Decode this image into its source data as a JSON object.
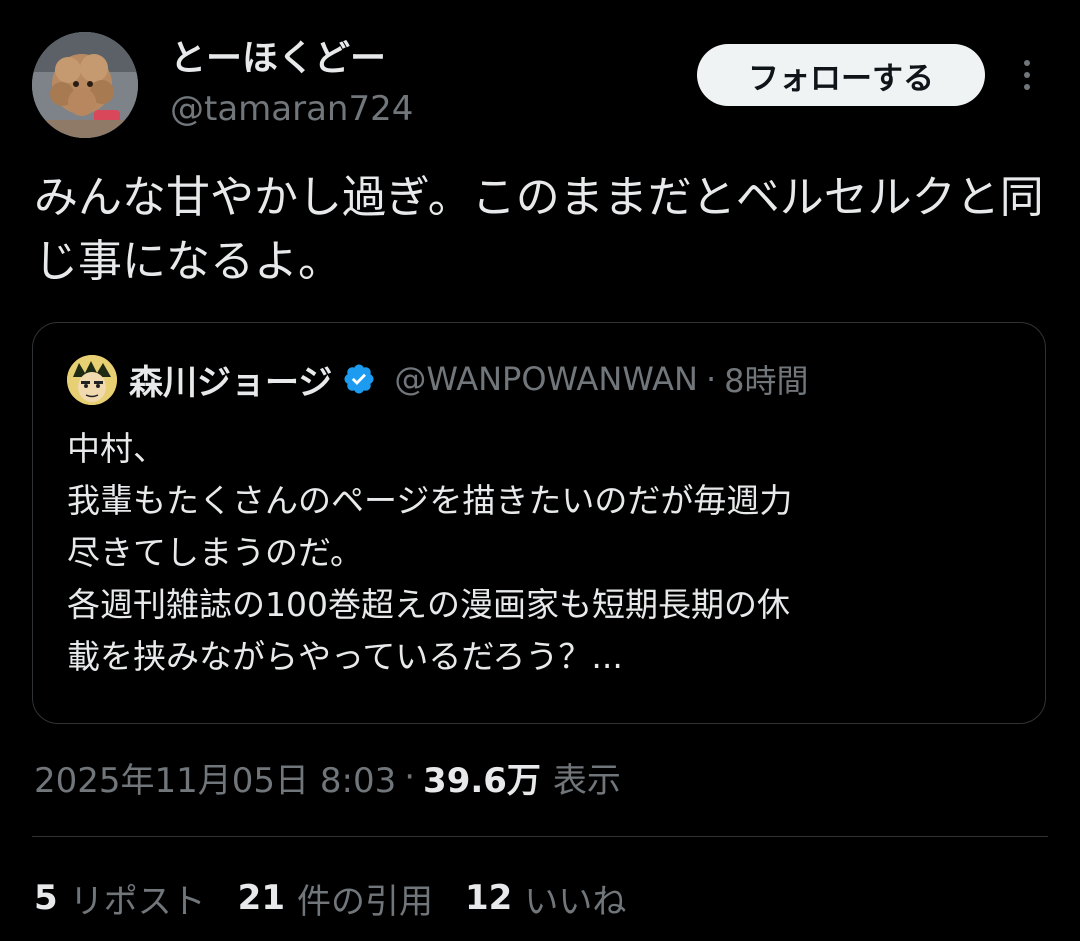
{
  "author": {
    "display_name": "とーほくどー",
    "handle": "@tamaran724",
    "avatar_icon": "poodle-avatar-icon"
  },
  "actions": {
    "follow_label": "フォローする",
    "more_icon": "more-dots-icon"
  },
  "tweet": {
    "text": "みんな甘やかし過ぎ。このままだとベルセルクと同じ事になるよ。"
  },
  "quote": {
    "display_name": "森川ジョージ",
    "verified_icon": "verified-badge-icon",
    "handle": "@WANPOWANWAN",
    "separator": "·",
    "time": "8時間",
    "lines": [
      "中村、",
      "我輩もたくさんのページを描きたいのだが毎週力",
      "尽きてしまうのだ。",
      "各週刊雑誌の100巻超えの漫画家も短期長期の休",
      "載を挟みながらやっているだろう？..."
    ]
  },
  "meta": {
    "timestamp": "2025年11月05日 8:03",
    "separator": "·",
    "views_count": "39.6万",
    "views_label": "表示"
  },
  "stats": {
    "reposts_count": "5",
    "reposts_label": "リポスト",
    "quotes_count": "21",
    "quotes_label": "件の引用",
    "likes_count": "12",
    "likes_label": "いいね"
  },
  "colors": {
    "background": "#000000",
    "text_primary": "#e7e9ea",
    "text_secondary": "#71767b",
    "border": "#2f3336",
    "verified": "#1d9bf0",
    "follow_button_bg": "#eff3f4"
  }
}
